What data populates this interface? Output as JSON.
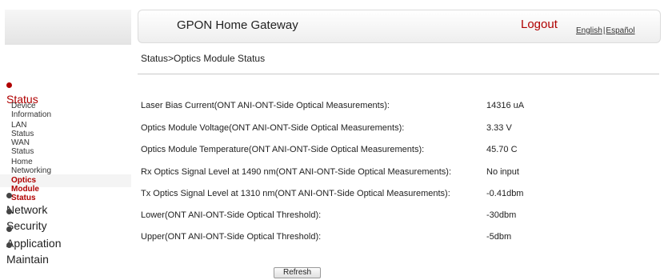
{
  "header": {
    "title": "GPON Home Gateway",
    "logout": "Logout",
    "lang_english": "English",
    "lang_separator": "|",
    "lang_spanish": "Español"
  },
  "breadcrumb": "Status>Optics Module Status",
  "sidebar": {
    "status_label": "Status",
    "sub_items": [
      {
        "label": "Device Information"
      },
      {
        "label": "LAN Status"
      },
      {
        "label": "WAN Status"
      },
      {
        "label": "Home Networking"
      },
      {
        "label": "Optics Module Status"
      }
    ],
    "groups": [
      {
        "label": "Network"
      },
      {
        "label": "Security"
      },
      {
        "label": "Application"
      },
      {
        "label": "Maintain"
      }
    ]
  },
  "rows": [
    {
      "label": "Laser Bias Current(ONT ANI-ONT-Side Optical Measurements):",
      "value": "14316 uA"
    },
    {
      "label": "Optics Module Voltage(ONT ANI-ONT-Side Optical Measurements):",
      "value": "3.33 V"
    },
    {
      "label": "Optics Module Temperature(ONT ANI-ONT-Side Optical Measurements):",
      "value": "45.70 C"
    },
    {
      "label": "Rx Optics Signal Level at 1490 nm(ONT ANI-ONT-Side Optical Measurements):",
      "value": "No input"
    },
    {
      "label": "Tx Optics Signal Level at 1310 nm(ONT ANI-ONT-Side Optical Measurements):",
      "value": "-0.41dbm"
    },
    {
      "label": "Lower(ONT ANI-ONT-Side Optical Threshold):",
      "value": "-30dbm"
    },
    {
      "label": "Upper(ONT ANI-ONT-Side Optical Threshold):",
      "value": "-5dbm"
    }
  ],
  "refresh_label": "Refresh",
  "colors": {
    "accent": "#b00000"
  }
}
